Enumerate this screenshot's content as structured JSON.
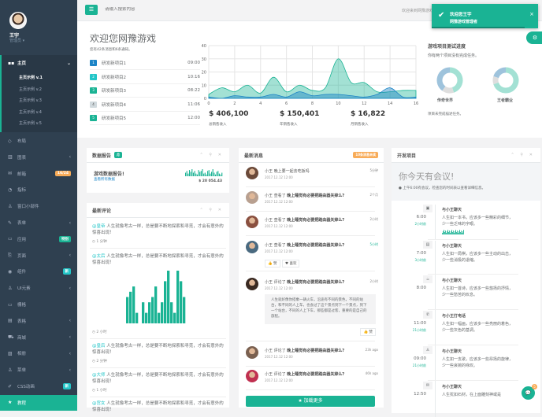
{
  "user": {
    "name": "王宇",
    "role": "管理员 ▾"
  },
  "sidebar": {
    "home": "主页",
    "sub": [
      "主页示例 v.1",
      "主页示例 v.2",
      "主页示例 v.3",
      "主页示例 v.4",
      "主页示例 v.5"
    ],
    "items": [
      {
        "icon": "◇",
        "label": "布局",
        "name": "layout"
      },
      {
        "icon": "▥",
        "label": "图表",
        "chev": "‹",
        "name": "charts"
      },
      {
        "icon": "✉",
        "label": "邮箱",
        "badge": "16/24",
        "badge_color": "#f8ac59",
        "name": "mailbox"
      },
      {
        "icon": "◔",
        "label": "指标",
        "name": "metrics"
      },
      {
        "icon": "♙",
        "label": "窗口小部件",
        "name": "widgets"
      },
      {
        "icon": "✎",
        "label": "表单",
        "chev": "‹",
        "name": "forms"
      },
      {
        "icon": "▭",
        "label": "应用",
        "badge": "特别",
        "badge_color": "#1ab394",
        "name": "apps"
      },
      {
        "icon": "⎘",
        "label": "页面",
        "chev": "‹",
        "name": "pages"
      },
      {
        "icon": "◉",
        "label": "组件",
        "badge": "新",
        "badge_color": "#23c6c8",
        "name": "components"
      },
      {
        "icon": "♙",
        "label": "UI元素",
        "chev": "‹",
        "name": "ui-elements"
      },
      {
        "icon": "▭",
        "label": "栅格",
        "name": "grid"
      },
      {
        "icon": "▤",
        "label": "表格",
        "chev": "‹",
        "name": "tables"
      },
      {
        "icon": "⛟",
        "label": "商城",
        "chev": "‹",
        "name": "shop"
      },
      {
        "icon": "▨",
        "label": "相册",
        "chev": "‹",
        "name": "gallery"
      },
      {
        "icon": "♙",
        "label": "菜单",
        "chev": "‹",
        "name": "menu"
      },
      {
        "icon": "✐",
        "label": "CSS动画",
        "badge": "新",
        "badge_color": "#23c6c8",
        "name": "css-animation"
      },
      {
        "icon": "★",
        "label": "教程",
        "name": "tutorial",
        "active": true
      }
    ]
  },
  "topbar": {
    "menu_icon": "☰",
    "search_placeholder": "请输入搜索内容",
    "welcome": "欢迎来到网豫游戏"
  },
  "toast": {
    "title": "欢迎您王宇",
    "body": "网豫游戏管理者",
    "close": "×"
  },
  "welcome": {
    "title": "欢迎您网豫游戏",
    "subtitle": "您有42条消息和6条通知。",
    "projects": [
      {
        "num": "1",
        "name": "研发新项目1",
        "time": "09:00",
        "color": "#1c84c6"
      },
      {
        "num": "2",
        "name": "研发新项目2",
        "time": "10:16",
        "color": "#23c6c8"
      },
      {
        "num": "3",
        "name": "研发新项目3",
        "time": "08:22",
        "color": "#1ab394"
      },
      {
        "num": "4",
        "name": "研发新项目4",
        "time": "11:06",
        "color": "#d1dade"
      },
      {
        "num": "5",
        "name": "研发新项目5",
        "time": "12:00",
        "color": "#1ab394"
      }
    ],
    "stats": [
      {
        "value": "$ 406,100",
        "label": "总销售收入"
      },
      {
        "value": "$ 150,401",
        "label": "年销售收入"
      },
      {
        "value": "$ 16,822",
        "label": "月销售收入"
      }
    ]
  },
  "chart_data": {
    "type": "area",
    "x": [
      0,
      1,
      2,
      3,
      4,
      5,
      6,
      7,
      8,
      9,
      10,
      11,
      12,
      13,
      14,
      15,
      16
    ],
    "xticks": [
      "0",
      "2",
      "4",
      "6",
      "8",
      "10",
      "12",
      "14",
      "16"
    ],
    "yticks": [
      "0",
      "10",
      "20",
      "30",
      "40"
    ],
    "xlim": [
      0,
      16
    ],
    "ylim": [
      0,
      40
    ],
    "series": [
      {
        "name": "A",
        "color": "#1ab394",
        "values": [
          3,
          8,
          5,
          10,
          4,
          16,
          5,
          10,
          6,
          8,
          30,
          12,
          12,
          5,
          5,
          6,
          6
        ]
      },
      {
        "name": "B",
        "color": "#1c84c6",
        "values": [
          1,
          0,
          2,
          1,
          1,
          3,
          1,
          5,
          2,
          3,
          3,
          2,
          1,
          3,
          8,
          1,
          1
        ]
      }
    ]
  },
  "progress": {
    "title": "游戏项目测试进度",
    "subtitle": "你有两个项目没有完成任务。",
    "donuts": [
      {
        "label": "传奇世界",
        "values": [
          45,
          15,
          40
        ]
      },
      {
        "label": "王者霸业",
        "values": [
          70,
          10,
          20
        ]
      }
    ],
    "colors": [
      "#a3e1d4",
      "#dedede",
      "#9ec3dc"
    ],
    "note": "项目未完成描述任务。"
  },
  "report": {
    "title": "数据报告",
    "label": "月",
    "label_color": "#1ab394",
    "heading": "游戏数据报告!",
    "link": "查看所有数据",
    "amount": "$ 20 054.43",
    "spark": [
      4,
      6,
      3,
      7,
      5,
      8,
      4,
      6,
      3,
      2,
      7,
      5,
      6,
      8,
      3,
      4,
      2,
      6,
      7,
      3,
      5,
      8,
      4,
      2,
      5,
      6,
      3,
      2,
      4
    ]
  },
  "tools": "⌃ ⚲ ✕",
  "comments": {
    "title": "最新评论",
    "items": [
      {
        "user": "@皇帝",
        "text": "人生就像考古一样，总是要不断地探索和寻觅，才会有意外的惊喜出现！",
        "ago": "◷ 1 分钟"
      },
      {
        "user": "@太后",
        "text": "人生就像考古一样，总是要不断地探索和寻觅，才会有意外的惊喜出现！",
        "ago": "◷ 2 小时"
      },
      {
        "user": "@皇后",
        "text": "人生就像考古一样，总是要不断地探索和寻觅，才会有意外的惊喜出现！",
        "ago": "◷ 2 分钟"
      },
      {
        "user": "@大师",
        "text": "人生就像考古一样，总是要不断地探索和寻觅，才会有意外的惊喜出现！",
        "ago": "◷ 1 小时"
      },
      {
        "user": "@宫女",
        "text": "人生就像考古一样，总是要不断地探索和寻觅，才会有意外的惊喜出现！"
      }
    ],
    "bars": [
      5,
      6,
      7,
      2,
      0,
      4,
      2,
      4,
      5,
      7,
      2,
      4,
      8,
      10,
      4,
      2,
      10,
      8,
      5
    ]
  },
  "messages": {
    "title": "最新消息",
    "badge": "10条消息未读",
    "load_more": "★ 加载更多",
    "like": "👍 赞",
    "love": "♥ 喜欢",
    "quote": "人生就好像你搭乘一辆火车，沿途有不同的景色，不同的站台，和不同的人上车，也会过了这个景点到下一个景点，到下一个站台，不同的人上下车，那些都是过客，重要的是自己的旅程。",
    "items": [
      {
        "who": "小王",
        "act": "晚上要一起去吃饭吗",
        "topic": "",
        "date": "2017.12.12 12:00",
        "when": "5分钟",
        "c": "#6b4a3a"
      },
      {
        "who": "小王",
        "act": "查看了",
        "topic": "晚上睡觉有必要把路由器关掉么?",
        "date": "2017.12.12 12:00",
        "when": "2个月",
        "c": "#b8a090"
      },
      {
        "who": "小王",
        "act": "查看了",
        "topic": "晚上睡觉有必要把路由器关掉么?",
        "date": "2017.12.12 12:00",
        "when": "2小时",
        "c": "#8a5040"
      },
      {
        "who": "小王",
        "act": "查看了",
        "topic": "晚上睡觉有必要把路由器关掉么?",
        "date": "2017.12.12 12:00",
        "when": "5小时",
        "c": "#4a6a80",
        "green": true
      },
      {
        "who": "小王",
        "act": "评论了",
        "topic": "晚上睡觉有必要把路由器关掉么?",
        "date": "2017.12.12 12:00",
        "when": "2小时",
        "c": "#3a2a22"
      },
      {
        "who": "小王",
        "act": "评论了",
        "topic": "晚上睡觉有必要把路由器关掉么?",
        "date": "2017.12.12 12:00",
        "when": "23h ago",
        "c": "#7a6050"
      },
      {
        "who": "小王",
        "act": "评论了",
        "topic": "晚上睡觉有必要把路由器关掉么?",
        "date": "2017.12.12 12:00",
        "when": "46h ago",
        "c": "#c03050"
      }
    ]
  },
  "dev": {
    "title": "开发项目",
    "meeting": "你今天有会议!",
    "note": "● 上午6:00有会议，检查您的时间表以查看详细信息。",
    "timeline": [
      {
        "icon": "▣",
        "time": "6:00",
        "ago": "2小时前",
        "title": "与小王聊天",
        "text": "人生如一本书，应该多一些精彩的细节，少一些乏味的字眼。"
      },
      {
        "icon": "▤",
        "time": "7:00",
        "ago": "3小时前",
        "title": "与小王聊天",
        "text": "人生如一局棋，应该多一些主动的出击，少一些消极的退缩。"
      },
      {
        "icon": "☕",
        "time": "8:00",
        "title": "与小王聊天",
        "text": "人生如一首诗，应该多一些悠扬的抒情，少一些愁苦的叹息。"
      },
      {
        "icon": "✆",
        "time": "11:00",
        "ago": "21小时前",
        "title": "与小王打电话",
        "text": "人生如一幅画，应该多一些亮丽的着色，少一些灰色的基调。"
      },
      {
        "icon": "♙",
        "time": "09:00",
        "ago": "21小时前",
        "title": "与小王聊天",
        "text": "人生如一支歌，应该多一些昂扬的旋律，少一些哀婉的咏叹。"
      },
      {
        "icon": "✉",
        "time": "12:50",
        "title": "与小王聊天",
        "text": "人生犹如石材，在上面雕刻神或是"
      }
    ]
  },
  "chat": {
    "count": "5"
  }
}
